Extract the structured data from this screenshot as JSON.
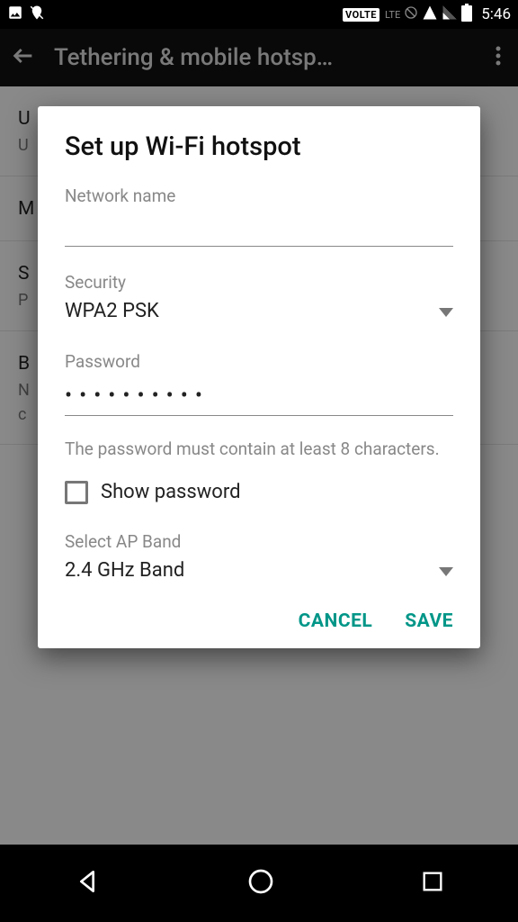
{
  "status": {
    "volte": "VOLTE",
    "lte": "LTE",
    "time": "5:46"
  },
  "appbar": {
    "title": "Tethering & mobile hotsp…"
  },
  "bg": {
    "row1_title": "U",
    "row1_sub": "U",
    "row2_title": "M",
    "row3_title": "S",
    "row3_sub": "P",
    "row4_title": "B",
    "row4_sub": "N",
    "row4_sub2": "c"
  },
  "dialog": {
    "title": "Set up Wi-Fi hotspot",
    "network_name_label": "Network name",
    "network_name_value": "",
    "security_label": "Security",
    "security_value": "WPA2 PSK",
    "password_label": "Password",
    "password_masked": "••••••••••",
    "helper": "The password must contain at least 8 characters.",
    "show_password_label": "Show password",
    "ap_band_label": "Select AP Band",
    "ap_band_value": "2.4 GHz Band",
    "cancel": "CANCEL",
    "save": "SAVE"
  }
}
